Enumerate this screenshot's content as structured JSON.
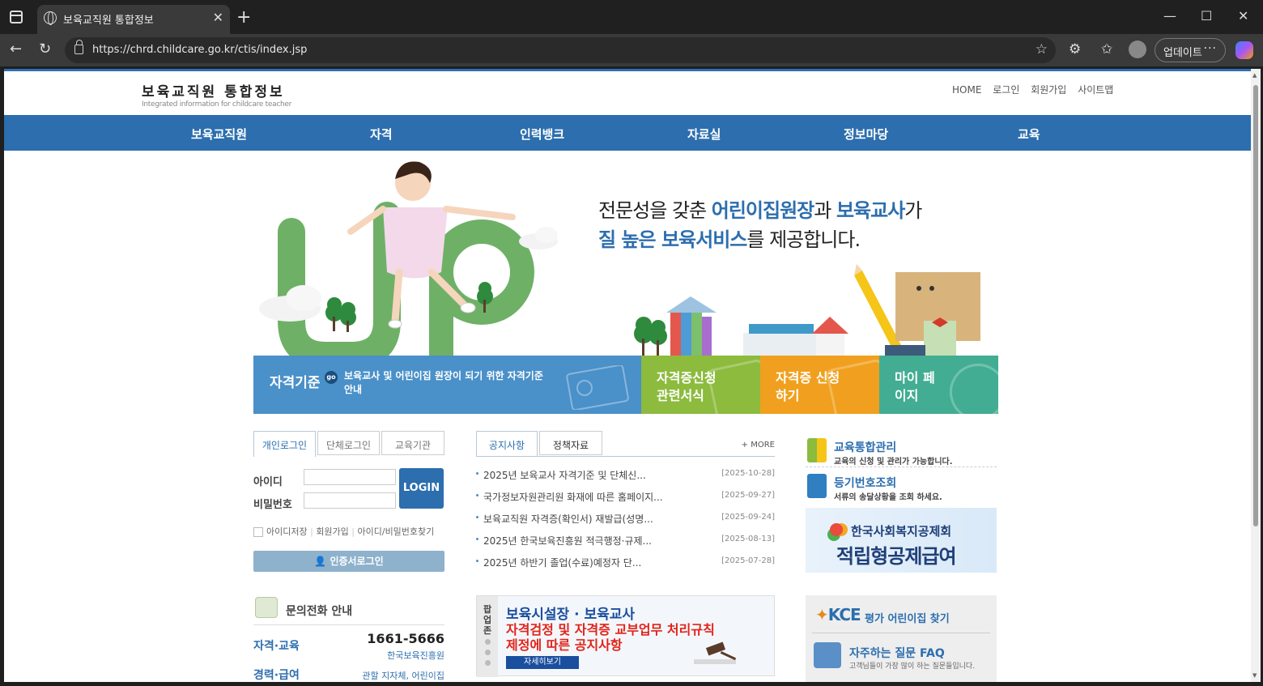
{
  "browser": {
    "tab_title": "보육교직원 통합정보",
    "url": "https://chrd.childcare.go.kr/ctis/index.jsp",
    "update_label": "업데이트"
  },
  "site": {
    "logo_kr": "보육교직원 통합정보",
    "logo_en": "Integrated information for childcare teacher",
    "util_nav": [
      "HOME",
      "로그인",
      "회원가입",
      "사이트맵"
    ],
    "gnb": [
      "보육교직원",
      "자격",
      "인력뱅크",
      "자료실",
      "정보마당",
      "교육"
    ]
  },
  "hero": {
    "line1_a": "전문성을 갖춘 ",
    "line1_b": "어린이집원장",
    "line1_c": "과 ",
    "line1_d": "보육교사",
    "line1_e": "가",
    "line2_a": "질 높은 보육서비스",
    "line2_b": "를 제공합니다."
  },
  "banners": {
    "main_title": "자격기준",
    "go": "go",
    "main_desc": "보육교사 및 어린이집 원장이 되기 위한 자격기준 안내",
    "tiles": [
      {
        "label": "자격증신청 관련서식",
        "color": "#8cbb3e"
      },
      {
        "label": "자격증 신청하기",
        "color": "#f0a01e"
      },
      {
        "label": "마이 페이지",
        "color": "#42ad92"
      }
    ]
  },
  "login": {
    "tabs": [
      "개인로그인",
      "단체로그인",
      "교육기관"
    ],
    "id_label": "아이디",
    "pw_label": "비밀번호",
    "login_button": "LOGIN",
    "save_id": "아이디저장",
    "join": "회원가입",
    "find": "아이디/비밀번호찾기",
    "cert_login": "인증서로그인"
  },
  "contact": {
    "title": "문의전화 안내",
    "rows": [
      {
        "label": "자격·교육",
        "phone": "1661-5666",
        "sub": "한국보육진흥원"
      },
      {
        "label": "경력·급여",
        "phone": "",
        "sub": "관할 지자체, 어린이집"
      }
    ]
  },
  "notice": {
    "tabs": [
      "공지사항",
      "정책자료"
    ],
    "more": "+ MORE",
    "items": [
      {
        "title": "2025년 보육교사 자격기준 및 단체신...",
        "date": "[2025-10-28]"
      },
      {
        "title": "국가정보자원관리원 화재에 따른 홈페이지...",
        "date": "[2025-09-27]"
      },
      {
        "title": "보육교직원 자격증(확인서) 재발급(성명...",
        "date": "[2025-09-24]"
      },
      {
        "title": "2025년 한국보육진흥원 적극행정·규제...",
        "date": "[2025-08-13]"
      },
      {
        "title": "2025년 하반기 졸업(수료)예정자 단...",
        "date": "[2025-07-28]"
      }
    ]
  },
  "popup": {
    "side": "팝업존",
    "line1": "보육시설장 · 보육교사",
    "line2": "자격검정 및 자격증 교부업무 처리규칙",
    "line3": "제정에 따른 공지사항",
    "button": "자세히보기"
  },
  "quick": [
    {
      "title": "교육통합관리",
      "desc": "교육의 신청 및 관리가 가능합니다."
    },
    {
      "title": "등기번호조회",
      "desc": "서류의 송달상황을 조회 하세요."
    }
  ],
  "welfare": {
    "line1": "한국사회복지공제회",
    "line2": "적립형공제급여"
  },
  "kce": {
    "logo": "KCE",
    "title": "평가 어린이집 찾기",
    "faq_title": "자주하는 질문 FAQ",
    "faq_desc": "고객님들이 가장 많이 하는 질문들입니다."
  }
}
